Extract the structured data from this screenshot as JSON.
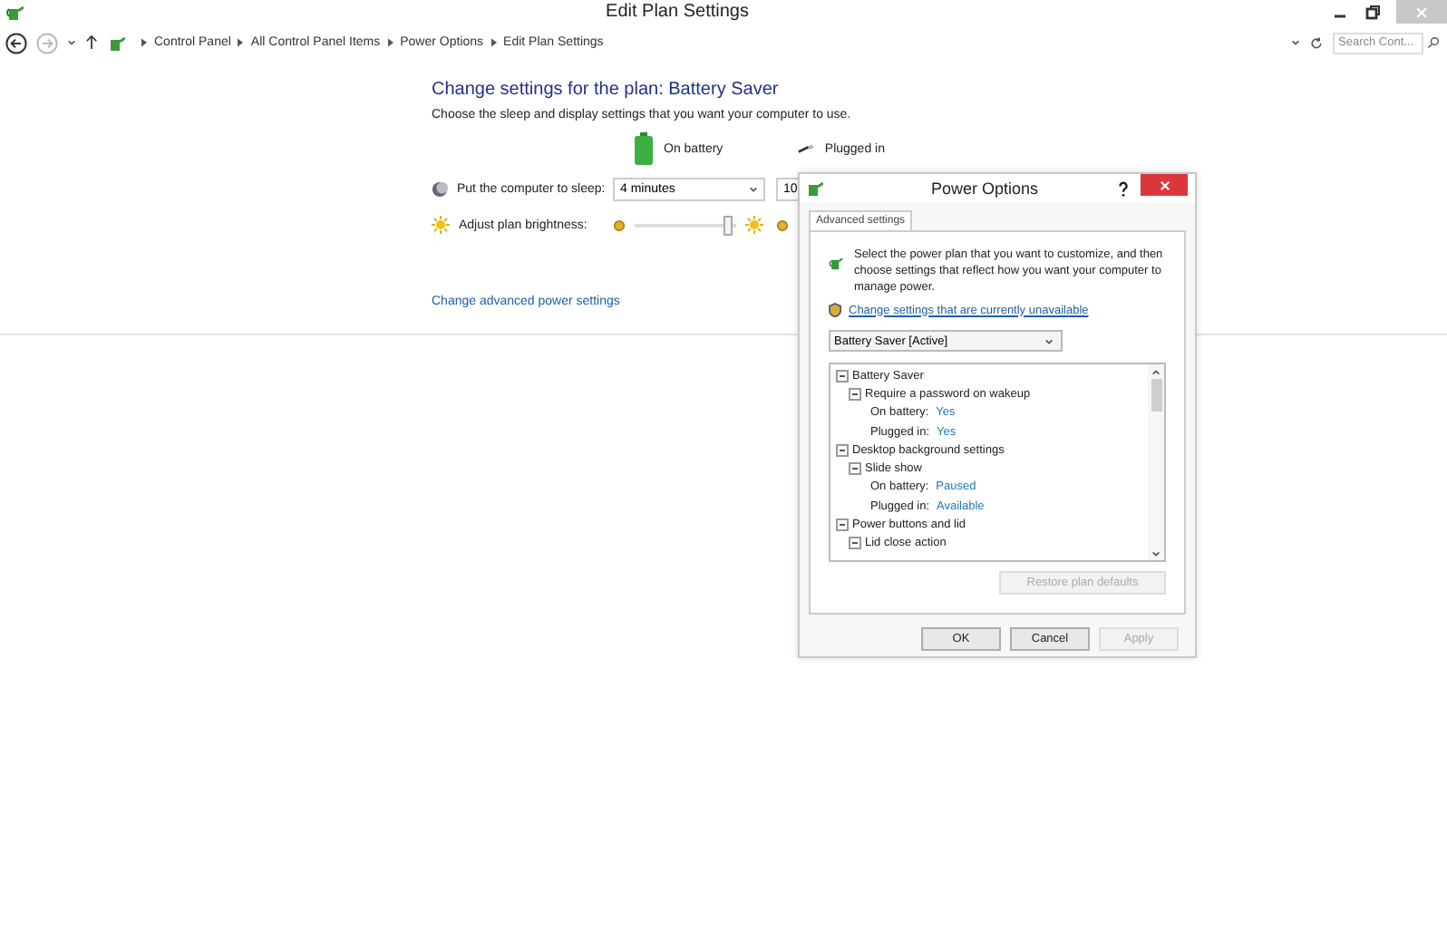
{
  "window": {
    "title": "Edit Plan Settings"
  },
  "breadcrumbs": [
    "Control Panel",
    "All Control Panel Items",
    "Power Options",
    "Edit Plan Settings"
  ],
  "search": {
    "placeholder": "Search Cont..."
  },
  "heading": "Change settings for the plan: Battery Saver",
  "description": "Choose the sleep and display settings that you want your computer to use.",
  "columns": [
    "On battery",
    "Plugged in"
  ],
  "settings": [
    {
      "kind": "dropdown",
      "label": "Put the computer to sleep:",
      "on_battery": "4 minutes",
      "plugged_in": "10"
    },
    {
      "kind": "slider",
      "label": "Adjust plan brightness:",
      "level": 0.92
    }
  ],
  "advanced_link": "Change advanced power settings",
  "dialog": {
    "title": "Power Options",
    "tabs": [
      {
        "label": "Advanced settings",
        "selected": true
      }
    ],
    "intro": "Select the power plan that you want to customize, and then choose settings that reflect how you want your computer to manage power.",
    "admin_link": "Change settings that are currently unavailable",
    "plan_select": "Battery Saver [Active]",
    "tree": [
      {
        "label": "Battery Saver",
        "expanded": true,
        "children": [
          {
            "label": "Require a password on wakeup",
            "expanded": true,
            "children": [
              {
                "label": "On battery:",
                "value": "Yes"
              },
              {
                "label": "Plugged in:",
                "value": "Yes"
              }
            ]
          }
        ]
      },
      {
        "label": "Desktop background settings",
        "expanded": true,
        "children": [
          {
            "label": "Slide show",
            "expanded": true,
            "children": [
              {
                "label": "On battery:",
                "value": "Paused"
              },
              {
                "label": "Plugged in:",
                "value": "Available"
              }
            ]
          }
        ]
      },
      {
        "label": "Power buttons and lid",
        "expanded": true,
        "children": [
          {
            "label": "Lid close action",
            "expanded": true
          }
        ]
      }
    ],
    "restore_button": {
      "label": "Restore plan defaults",
      "disabled": true
    },
    "buttons": [
      {
        "label": "OK",
        "disabled": false
      },
      {
        "label": "Cancel",
        "disabled": false
      },
      {
        "label": "Apply",
        "disabled": true
      }
    ]
  }
}
